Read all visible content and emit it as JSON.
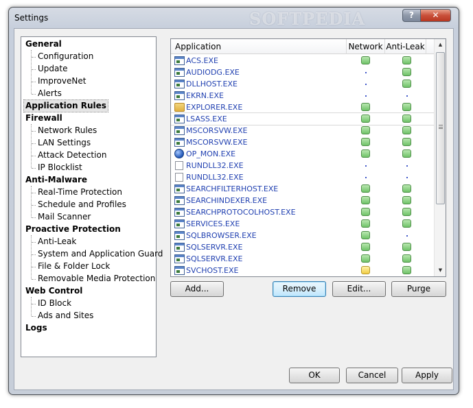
{
  "window": {
    "title": "Settings",
    "watermark": "SOFTPEDIA"
  },
  "titlebar": {
    "help_label": "?",
    "close_label": "✕"
  },
  "tree": [
    {
      "label": "General",
      "level": 0
    },
    {
      "label": "Configuration",
      "level": 1
    },
    {
      "label": "Update",
      "level": 1
    },
    {
      "label": "ImproveNet",
      "level": 1
    },
    {
      "label": "Alerts",
      "level": 1
    },
    {
      "label": "Application Rules",
      "level": 0,
      "selected": true
    },
    {
      "label": "Firewall",
      "level": 0
    },
    {
      "label": "Network Rules",
      "level": 1
    },
    {
      "label": "LAN Settings",
      "level": 1
    },
    {
      "label": "Attack Detection",
      "level": 1
    },
    {
      "label": "IP Blocklist",
      "level": 1
    },
    {
      "label": "Anti-Malware",
      "level": 0
    },
    {
      "label": "Real-Time Protection",
      "level": 1
    },
    {
      "label": "Schedule and Profiles",
      "level": 1
    },
    {
      "label": "Mail Scanner",
      "level": 1
    },
    {
      "label": "Proactive Protection",
      "level": 0
    },
    {
      "label": "Anti-Leak",
      "level": 1
    },
    {
      "label": "System and Application Guard",
      "level": 1
    },
    {
      "label": "File & Folder Lock",
      "level": 1
    },
    {
      "label": "Removable Media Protection",
      "level": 1
    },
    {
      "label": "Web Control",
      "level": 0
    },
    {
      "label": "ID Block",
      "level": 1
    },
    {
      "label": "Ads and Sites",
      "level": 1
    },
    {
      "label": "Logs",
      "level": 0
    }
  ],
  "list": {
    "columns": {
      "application": "Application",
      "network": "Network",
      "anti_leak": "Anti-Leak"
    },
    "rows": [
      {
        "name": "ACS.EXE",
        "icon": "window-app-icon",
        "network": "allow",
        "anti_leak": "allow"
      },
      {
        "name": "AUDIODG.EXE",
        "icon": "window-app-icon",
        "network": "none",
        "anti_leak": "allow"
      },
      {
        "name": "DLLHOST.EXE",
        "icon": "window-app-icon",
        "network": "none",
        "anti_leak": "allow"
      },
      {
        "name": "EKRN.EXE",
        "icon": "window-app-icon",
        "network": "none",
        "anti_leak": "none"
      },
      {
        "name": "EXPLORER.EXE",
        "icon": "folder-app-icon",
        "network": "allow",
        "anti_leak": "allow"
      },
      {
        "name": "LSASS.EXE",
        "icon": "window-app-icon",
        "network": "allow",
        "anti_leak": "allow",
        "highlighted": true
      },
      {
        "name": "MSCORSVW.EXE",
        "icon": "window-app-icon",
        "network": "allow",
        "anti_leak": "allow"
      },
      {
        "name": "MSCORSVW.EXE",
        "icon": "window-app-icon",
        "network": "allow",
        "anti_leak": "allow"
      },
      {
        "name": "OP_MON.EXE",
        "icon": "globe-app-icon",
        "network": "allow",
        "anti_leak": "allow"
      },
      {
        "name": "RUNDLL32.EXE",
        "icon": "document-app-icon",
        "network": "none",
        "anti_leak": "none"
      },
      {
        "name": "RUNDLL32.EXE",
        "icon": "document-app-icon",
        "network": "none",
        "anti_leak": "none"
      },
      {
        "name": "SEARCHFILTERHOST.EXE",
        "icon": "window-app-icon",
        "network": "allow",
        "anti_leak": "allow"
      },
      {
        "name": "SEARCHINDEXER.EXE",
        "icon": "window-app-icon",
        "network": "allow",
        "anti_leak": "allow"
      },
      {
        "name": "SEARCHPROTOCOLHOST.EXE",
        "icon": "window-app-icon",
        "network": "allow",
        "anti_leak": "allow"
      },
      {
        "name": "SERVICES.EXE",
        "icon": "window-app-icon",
        "network": "allow",
        "anti_leak": "allow"
      },
      {
        "name": "SQLBROWSER.EXE",
        "icon": "window-app-icon",
        "network": "allow",
        "anti_leak": "none"
      },
      {
        "name": "SQLSERVR.EXE",
        "icon": "window-app-icon",
        "network": "allow",
        "anti_leak": "allow"
      },
      {
        "name": "SQLSERVR.EXE",
        "icon": "window-app-icon",
        "network": "allow",
        "anti_leak": "allow"
      },
      {
        "name": "SVCHOST.EXE",
        "icon": "window-app-icon",
        "network": "warn",
        "anti_leak": "allow"
      }
    ]
  },
  "list_buttons": {
    "add": "Add...",
    "remove": "Remove",
    "edit": "Edit...",
    "purge": "Purge"
  },
  "dialog_buttons": {
    "ok": "OK",
    "cancel": "Cancel",
    "apply": "Apply"
  },
  "colors": {
    "allow": "#6fc368",
    "warn": "#f1cc44",
    "app_text": "#1f3fb0",
    "titlebar": "#c7cfdc"
  }
}
